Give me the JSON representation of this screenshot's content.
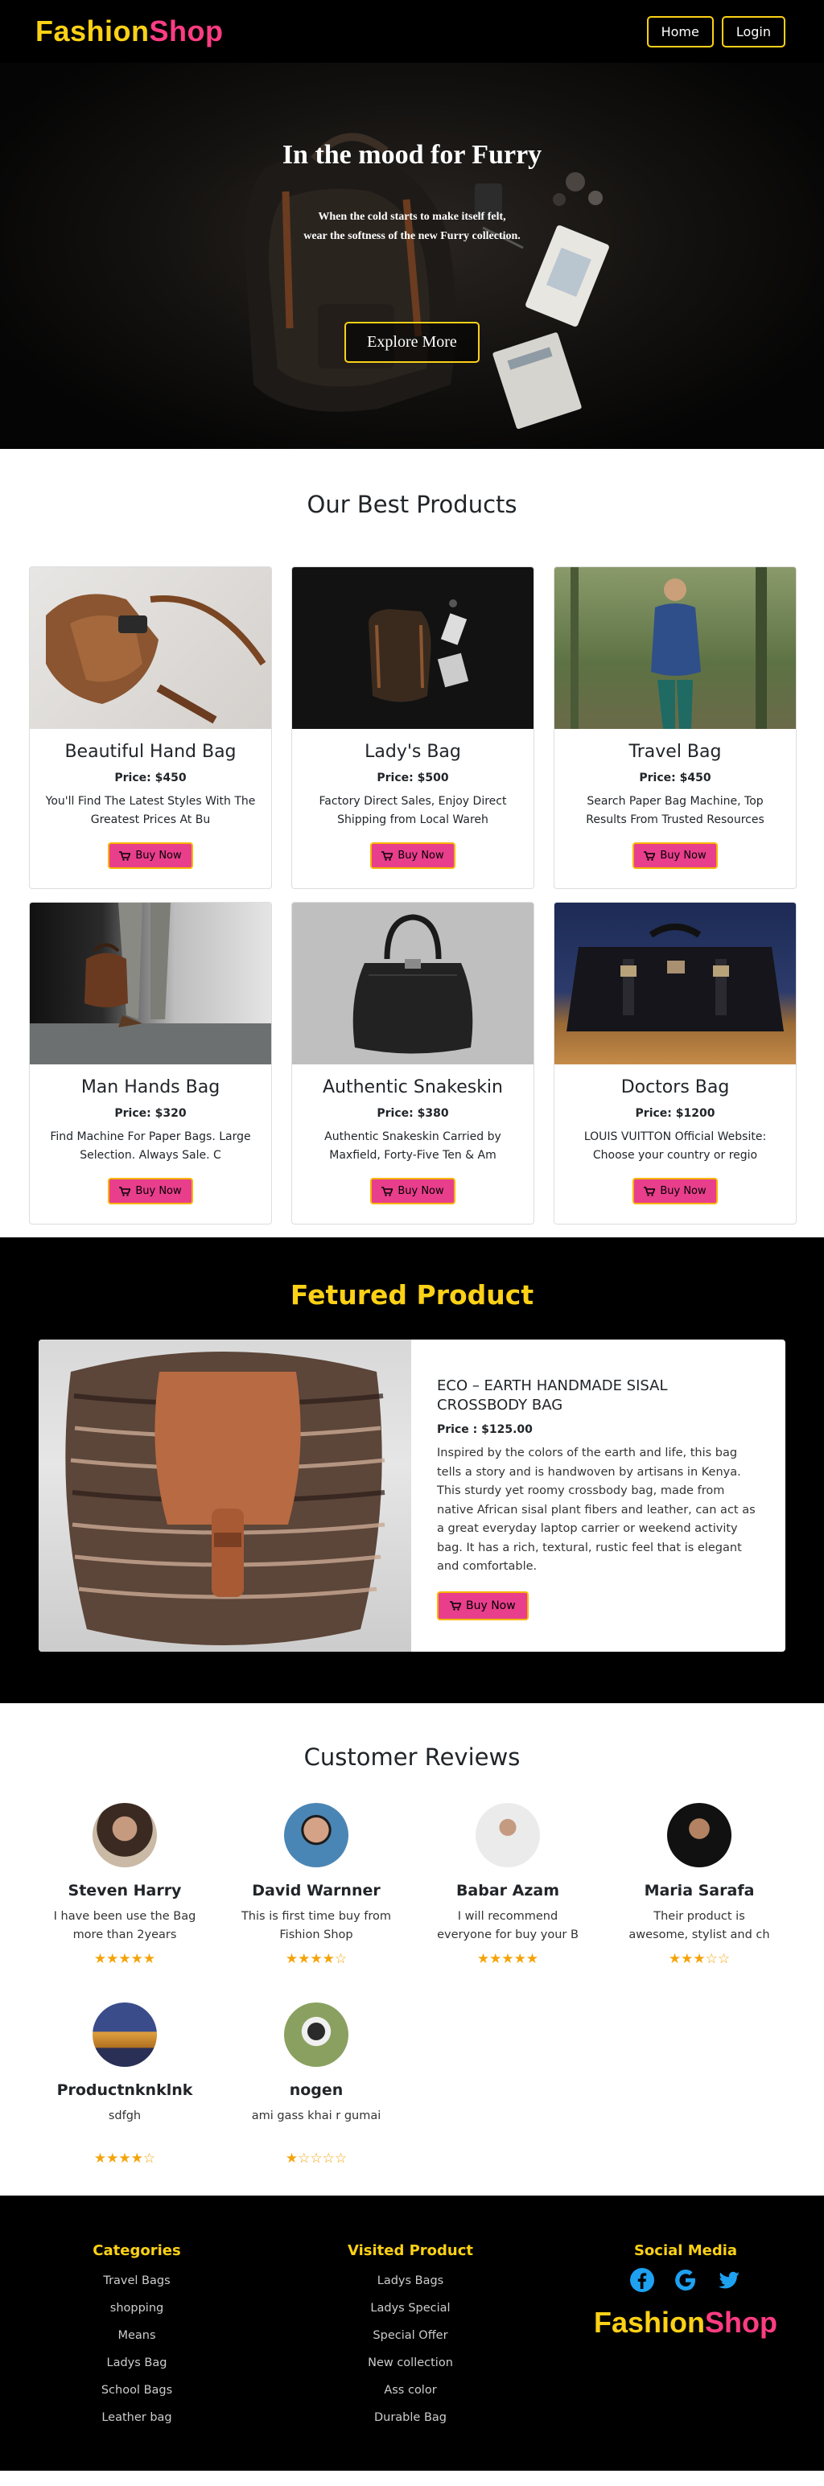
{
  "nav": {
    "brand_part1": "Fashion",
    "brand_part2": "Shop",
    "home": "Home",
    "login": "Login"
  },
  "hero": {
    "title": "In the mood for Furry",
    "subtitle_line1": "When the cold starts to make itself felt,",
    "subtitle_line2": "wear the softness of the new Furry collection.",
    "button": "Explore More"
  },
  "products": {
    "title": "Our Best Products",
    "buy_label": "Buy Now",
    "items": [
      {
        "name": "Beautiful Hand Bag",
        "price": "Price: $450",
        "desc": "You'll Find The Latest Styles With The Greatest Prices At Bu"
      },
      {
        "name": "Lady's Bag",
        "price": "Price: $500",
        "desc": "Factory Direct Sales, Enjoy Direct Shipping from Local Wareh"
      },
      {
        "name": "Travel Bag",
        "price": "Price: $450",
        "desc": "Search Paper Bag Machine, Top Results From Trusted Resources"
      },
      {
        "name": "Man Hands Bag",
        "price": "Price: $320",
        "desc": "Find Machine For Paper Bags. Large Selection. Always Sale. C"
      },
      {
        "name": "Authentic Snakeskin",
        "price": "Price: $380",
        "desc": "Authentic Snakeskin Carried by Maxfield, Forty-Five Ten & Am"
      },
      {
        "name": "Doctors Bag",
        "price": "Price: $1200",
        "desc": "LOUIS VUITTON Official Website: Choose your country or regio"
      }
    ]
  },
  "featured": {
    "title": "Fetured Product",
    "name": "ECO – EARTH HANDMADE SISAL CROSSBODY BAG",
    "price": "Price : $125.00",
    "desc": "Inspired by the colors of the earth and life, this bag tells a story and is handwoven by artisans in Kenya. This sturdy yet roomy crossbody bag, made from native African sisal plant fibers and leather, can act as a great everyday laptop carrier or weekend activity bag. It has a rich, textural, rustic feel that is elegant and comfortable.",
    "button": "Buy Now"
  },
  "reviews": {
    "title": "Customer Reviews",
    "items": [
      {
        "name": "Steven Harry",
        "text": "I have been use the Bag more than 2years",
        "stars": "★★★★★"
      },
      {
        "name": "David Warnner",
        "text": "This is first time buy from Fishion Shop",
        "stars": "★★★★☆"
      },
      {
        "name": "Babar Azam",
        "text": "I will recommend everyone for buy your B",
        "stars": "★★★★★"
      },
      {
        "name": "Maria Sarafa",
        "text": "Their product is awesome, stylist and ch",
        "stars": "★★★☆☆"
      },
      {
        "name": "Productnknklnk",
        "text": "sdfgh",
        "stars": "★★★★☆"
      },
      {
        "name": "nogen",
        "text": "ami gass khai r gumai",
        "stars": "★☆☆☆☆"
      }
    ]
  },
  "footer": {
    "categories_title": "Categories",
    "categories": [
      "Travel Bags",
      "shopping",
      "Means",
      "Ladys Bag",
      "School Bags",
      "Leather bag"
    ],
    "visited_title": "Visited Product",
    "visited": [
      "Ladys Bags",
      "Ladys Special",
      "Special Offer",
      "New collection",
      "Ass color",
      "Durable Bag"
    ],
    "social_title": "Social Media",
    "icons": [
      "facebook-icon",
      "google-icon",
      "twitter-icon"
    ],
    "brand_part1": "Fashion",
    "brand_part2": "Shop"
  },
  "colors": {
    "brand_yellow": "#fcd116",
    "brand_pink": "#ff3c83",
    "buy_button": "#e83e8c",
    "star": "#f4a40a"
  }
}
